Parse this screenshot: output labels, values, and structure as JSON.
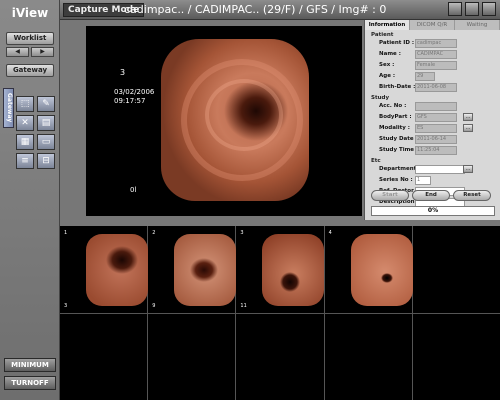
{
  "app": {
    "logo": "iView"
  },
  "sidebar": {
    "worklist_label": "Worklist",
    "gateway_label": "Gateway",
    "gateway_tab_label": "Gateway",
    "minimum_label": "MINIMUM",
    "turnoff_label": "TURNOFF"
  },
  "header": {
    "capture_mode_label": "Capture Mode",
    "title": "cadimpac..  /  CADIMPAC..  (29/F)  /  GFS  /  Img# : 0"
  },
  "viewer": {
    "overlay_index": "3",
    "overlay_date": "03/02/2006",
    "overlay_time": "09:17:57",
    "overlay_marker": "0l"
  },
  "panel": {
    "tabs": [
      {
        "label": "Information",
        "active": true
      },
      {
        "label": "DICOM Q/R",
        "active": false
      },
      {
        "label": "Waiting",
        "active": false
      }
    ],
    "patient_section": "Patient",
    "study_section": "Study",
    "etc_section": "Etc",
    "fields": {
      "patient_id": {
        "label": "Patient ID :",
        "value": "cadimpac"
      },
      "name": {
        "label": "Name :",
        "value": "CADIMPAC"
      },
      "sex": {
        "label": "Sex :",
        "value": "Female"
      },
      "age": {
        "label": "Age :",
        "value": "29"
      },
      "birth_date": {
        "label": "Birth-Date :",
        "value": "2011-06-08"
      },
      "acc_no": {
        "label": "Acc. No :",
        "value": ""
      },
      "body_part": {
        "label": "BodyPart :",
        "value": "GFS"
      },
      "modality": {
        "label": "Modality :",
        "value": "ES"
      },
      "study_date": {
        "label": "Study Date :",
        "value": "2011-06-14"
      },
      "study_time": {
        "label": "Study Time :",
        "value": "11:25:04"
      },
      "department": {
        "label": "Department :",
        "value": ""
      },
      "series_no": {
        "label": "Series No :",
        "value": "1"
      },
      "ref_doctor": {
        "label": "Ref. Doctor :",
        "value": ""
      },
      "description": {
        "label": "Description :",
        "value": ""
      }
    },
    "actions": {
      "start": "Start",
      "end": "End",
      "reset": "Reset"
    },
    "progress": {
      "value_percent": 0,
      "label": "0%"
    }
  },
  "thumbnails": [
    {
      "index": "1",
      "number": "3"
    },
    {
      "index": "2",
      "number": "9"
    },
    {
      "index": "3",
      "number": "11"
    },
    {
      "index": "4",
      "number": ""
    }
  ]
}
